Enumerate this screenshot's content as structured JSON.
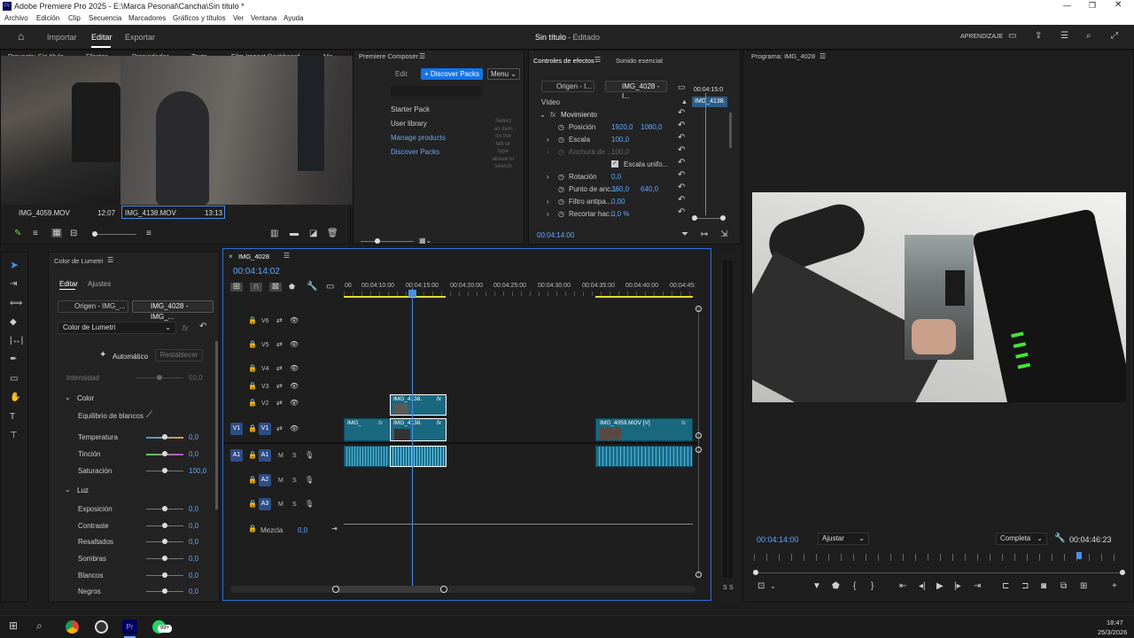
{
  "window": {
    "title": "Adobe Premiere Pro 2025 - E:\\Marca Pesonal\\Cancha\\Sin titulo *"
  },
  "menu": [
    "Archivo",
    "Edición",
    "Clip",
    "Secuencia",
    "Marcadores",
    "Gráficos y títulos",
    "Ver",
    "Ventana",
    "Ayuda"
  ],
  "appbar": {
    "tabs": [
      "Importar",
      "Editar",
      "Exportar"
    ],
    "active_tab": "Editar",
    "project_title": "Sin título",
    "status": "- Editado",
    "learn": "APRENDIZAJE"
  },
  "source_panel": {
    "tabs": [
      "Proyecto: Sin título",
      "Efectos",
      "Propiedades",
      "Texto",
      "Film Impact Dashboard",
      "Me"
    ],
    "thumbs": [
      {
        "name": "IMG_4059.MOV",
        "duration": "12:07"
      },
      {
        "name": "IMG_4138.MOV",
        "duration": "13:13"
      }
    ]
  },
  "composer": {
    "title": "Premiere Composer",
    "edit": "Edit",
    "discover_btn": "+ Discover Packs",
    "menu_btn": "Menu",
    "items": [
      "Starter Pack",
      "User library",
      "Manage products",
      "Discover Packs"
    ],
    "hint": "Select an item on the left or type above to search"
  },
  "effects": {
    "tabs": [
      "Controles de efectos",
      "Sonido esencial"
    ],
    "source_tab": "Origen - I...",
    "seq_tab": "IMG_4028 - I...",
    "timecode_head": "00:04:15:0",
    "clip_label": "IMG_4138.",
    "video": "Vídeo",
    "movement": "Movimiento",
    "params": [
      {
        "name": "Posición",
        "v1": "1920,0",
        "v2": "1080,0"
      },
      {
        "name": "Escala",
        "v1": "100,0",
        "v2": ""
      },
      {
        "name": "Anchura de ...",
        "v1": "100,0",
        "v2": ""
      },
      {
        "name": "Rotación",
        "v1": "0,0",
        "v2": ""
      },
      {
        "name": "Punto de anc...",
        "v1": "360,0",
        "v2": "640,0"
      },
      {
        "name": "Filtro antipa...",
        "v1": "0,00",
        "v2": ""
      },
      {
        "name": "Recortar hac...",
        "v1": "0,0 %",
        "v2": ""
      }
    ],
    "uniform": "Escala unifo...",
    "timecode": "00:04:14:00"
  },
  "program": {
    "title": "Programa: IMG_4028",
    "timecode": "00:04:14:00",
    "fit": "Ajustar",
    "quality": "Completa",
    "duration": "00:04:46:23"
  },
  "lumetri": {
    "title": "Color de Lumetri",
    "tabs": [
      "Editar",
      "Ajustes"
    ],
    "source": "Origen - IMG_...",
    "seq": "IMG_4028 - IMG_...",
    "dropdown": "Color de Lumetri",
    "auto": "Automático",
    "reset": "Restablecer",
    "intensity": {
      "label": "Intensidad",
      "value": "50,0"
    },
    "color_section": "Color",
    "wb": "Equilibrio de blancos",
    "color_rows": [
      {
        "label": "Temperatura",
        "value": "0,0"
      },
      {
        "label": "Tinción",
        "value": "0,0"
      },
      {
        "label": "Saturación",
        "value": "100,0"
      }
    ],
    "light_section": "Luz",
    "light_rows": [
      {
        "label": "Exposición",
        "value": "0,0"
      },
      {
        "label": "Contraste",
        "value": "0,0"
      },
      {
        "label": "Resaltados",
        "value": "0,0"
      },
      {
        "label": "Sombras",
        "value": "0,0"
      },
      {
        "label": "Blancos",
        "value": "0,0"
      },
      {
        "label": "Negros",
        "value": "0,0"
      }
    ]
  },
  "timeline": {
    "seq_name": "IMG_4028",
    "timecode": "00:04:14:02",
    "ruler": [
      "00",
      "00:04:10:00",
      "00:04:15:00",
      "00:04:20:00",
      "00:04:25:00",
      "00:04:30:00",
      "00:04:35:00",
      "00:04:40:00",
      "00:04:45:"
    ],
    "video_tracks": [
      "V6",
      "V5",
      "V4",
      "V3",
      "V2",
      "V1"
    ],
    "audio_tracks": [
      "A1",
      "A2",
      "A3"
    ],
    "mix": {
      "label": "Mezcla",
      "value": "0,0"
    },
    "clips": {
      "v2": "IMG_4138.",
      "v1a": "IMG_",
      "v1b": "IMG_4138.",
      "v1c": "IMG_4059.MOV [V]"
    },
    "fx": "fx"
  },
  "taskbar": {
    "time": "18:47",
    "date": "25/3/2026",
    "badge": "99+"
  }
}
